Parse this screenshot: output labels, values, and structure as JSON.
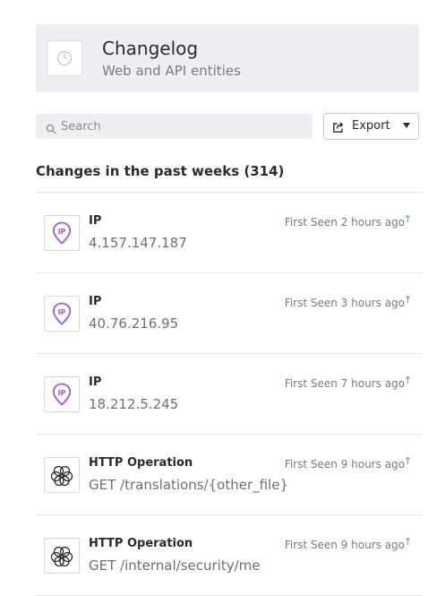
{
  "header": {
    "title": "Changelog",
    "subtitle": "Web and API entities",
    "icon": "clock-icon"
  },
  "toolbar": {
    "search_placeholder": "Search",
    "search_value": "",
    "export_label": "Export",
    "export_icon": "share-icon"
  },
  "section": {
    "heading": "Changes in the past weeks (314)"
  },
  "colors": {
    "ip_icon": "#a25ad9",
    "trend_up": "#2fb36e",
    "header_bg": "#eeeef3"
  },
  "changes": [
    {
      "type": "IP",
      "value": "4.157.147.187",
      "meta": "First Seen 2 hours ago",
      "trend": "↑",
      "icon": "ip-location-pin-icon"
    },
    {
      "type": "IP",
      "value": "40.76.216.95",
      "meta": "First Seen 3 hours ago",
      "trend": "↑",
      "icon": "ip-location-pin-icon"
    },
    {
      "type": "IP",
      "value": "18.212.5.245",
      "meta": "First Seen 7 hours ago",
      "trend": "↑",
      "icon": "ip-location-pin-icon"
    },
    {
      "type": "HTTP Operation",
      "value": "GET /translations/{other_file}",
      "meta": "First Seen 9 hours ago",
      "trend": "↑",
      "icon": "http-operation-icon"
    },
    {
      "type": "HTTP Operation",
      "value": "GET /internal/security/me",
      "meta": "First Seen 9 hours ago",
      "trend": "↑",
      "icon": "http-operation-icon"
    }
  ]
}
